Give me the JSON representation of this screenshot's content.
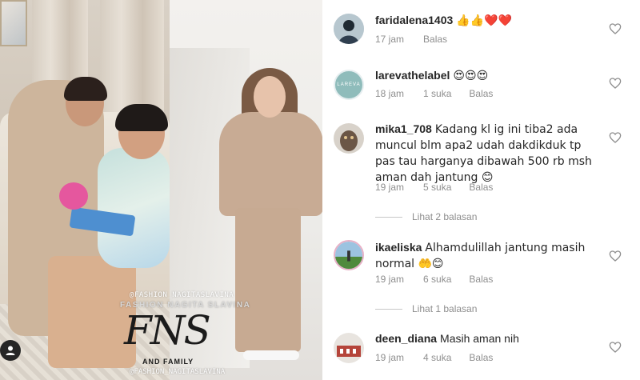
{
  "photo": {
    "watermark_handle": "@FASHION_NAGITASLAVINA",
    "watermark_brand": "FASHION NAGITA SLAVINA",
    "watermark_logo": "FNS",
    "watermark_family": "AND FAMILY",
    "watermark_handle_bottom": "@FASHION_NAGITASLAVINA"
  },
  "reply_label": "Balas",
  "comments": [
    {
      "username": "faridalena1403",
      "text": "👍👍❤️❤️",
      "time": "17 jam",
      "likes": "",
      "reply": "Balas",
      "avatar_color": "#2f3f4f"
    },
    {
      "username": "larevathelabel",
      "text": "😍😍😍",
      "time": "18 jam",
      "likes": "1 suka",
      "reply": "Balas",
      "avatar_color": "#8fbcbb",
      "avatar_text": "LAREVA"
    },
    {
      "username": "mika1_708",
      "text": "Kadang kl ig ini tiba2 ada muncul blm apa2 udah dakdikduk tp pas tau harganya dibawah 500 rb msh aman dah jantung 😊",
      "time": "19 jam",
      "likes": "5 suka",
      "reply": "Balas",
      "avatar_color": "#5b4a3e",
      "replies_label": "Lihat 2 balasan"
    },
    {
      "username": "ikaeliska",
      "text": "Alhamdulillah jantung masih normal 🤲😊",
      "time": "19 jam",
      "likes": "6 suka",
      "reply": "Balas",
      "avatar_color": "#3b7a3a",
      "replies_label": "Lihat 1 balasan"
    },
    {
      "username": "deen_diana",
      "text": "Masih aman nih",
      "time": "19 jam",
      "likes": "4 suka",
      "reply": "Balas",
      "avatar_color": "#a5443c"
    }
  ]
}
